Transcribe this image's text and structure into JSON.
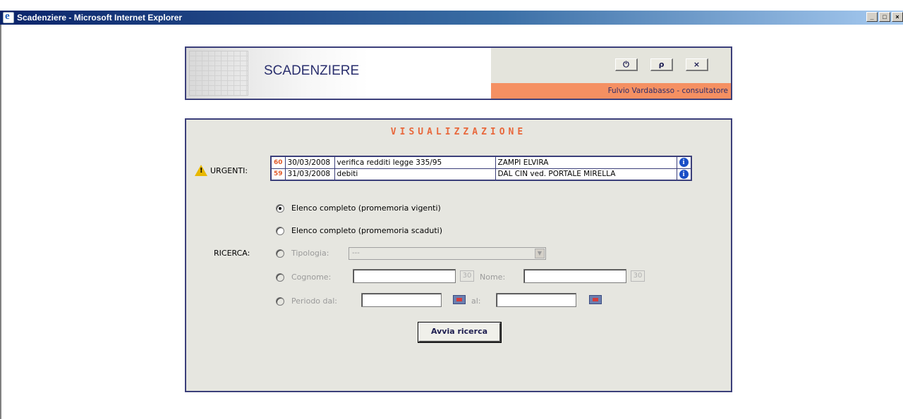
{
  "window": {
    "title": "Scadenziere - Microsoft Internet Explorer",
    "controls": [
      "_",
      "□",
      "×"
    ]
  },
  "header": {
    "app_title": "SCADENZIERE",
    "buttons": [
      {
        "icon": "power-icon",
        "glyph": "⏻"
      },
      {
        "icon": "key-icon",
        "glyph": "ρ"
      },
      {
        "icon": "close-icon",
        "glyph": "×"
      }
    ],
    "user": "Fulvio Vardabasso - consultatore"
  },
  "main": {
    "section_title": "VISUALIZZAZIONE",
    "urgent_label": "URGENTI:",
    "urgent_rows": [
      {
        "days": "60",
        "date": "30/03/2008",
        "description": "verifica redditi legge 335/95",
        "name": "ZAMPI ELVIRA"
      },
      {
        "days": "59",
        "date": "31/03/2008",
        "description": "debiti",
        "name": "DAL CIN ved. PORTALE MIRELLA"
      }
    ],
    "info_glyph": "i",
    "options": {
      "complete_active": "Elenco completo (promemoria vigenti)",
      "complete_expired": "Elenco completo (promemoria scaduti)"
    },
    "ricerca_label": "RICERCA:",
    "tipologia_label": "Tipologia:",
    "tipologia_value": "---",
    "cognome_label": "Cognome:",
    "cognome_max": "30",
    "nome_label": "Nome:",
    "nome_max": "30",
    "periodo_label": "Periodo dal:",
    "al_label": "al:",
    "search_button": "Avvia ricerca"
  }
}
